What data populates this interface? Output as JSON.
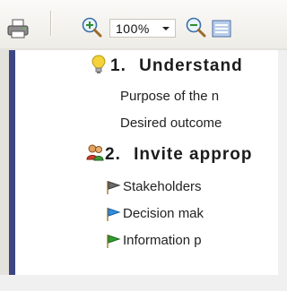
{
  "toolbar": {
    "zoom_value": "100%",
    "icons": [
      "print-icon",
      "zoom-in-icon",
      "zoom-dropdown-arrow-icon",
      "zoom-out-icon",
      "fit-page-icon"
    ]
  },
  "outline": {
    "sections": [
      {
        "icon": "lightbulb-icon",
        "number": "1.",
        "title": "Understand",
        "items": [
          {
            "icon": null,
            "text": "Purpose of the n"
          },
          {
            "icon": null,
            "text": "Desired outcome"
          }
        ]
      },
      {
        "icon": "people-icon",
        "number": "2.",
        "title": "Invite approp",
        "items": [
          {
            "icon": "grey-flag-icon",
            "text": "Stakeholders"
          },
          {
            "icon": "blue-flag-icon",
            "text": "Decision mak"
          },
          {
            "icon": "green-flag-icon",
            "text": "Information p"
          }
        ]
      }
    ]
  },
  "colors": {
    "accent_bar": "#3c4680",
    "bulb": "#f3d23a",
    "grey_flag": "#6b6b6b",
    "blue_flag": "#2f8fe0",
    "green_flag": "#2f9e2f"
  }
}
